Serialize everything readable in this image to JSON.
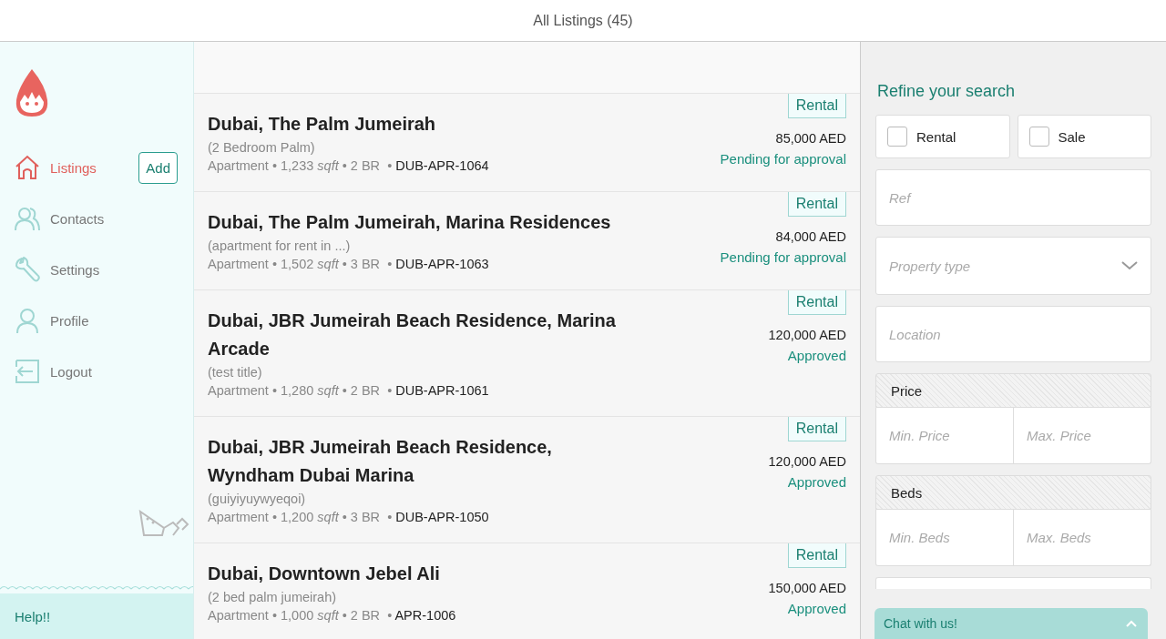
{
  "header": {
    "title": "All Listings (45)"
  },
  "sidebar": {
    "items": [
      {
        "label": "Listings",
        "selected": true
      },
      {
        "label": "Contacts",
        "selected": false
      },
      {
        "label": "Settings",
        "selected": false
      },
      {
        "label": "Profile",
        "selected": false
      },
      {
        "label": "Logout",
        "selected": false
      }
    ],
    "add_button": "Add",
    "help": "Help!!"
  },
  "listings": [
    {
      "title": "Dubai, The Palm Jumeirah",
      "subtitle": "(2 Bedroom Palm)",
      "details": "Apartment • 1,233 *sqft* • 2 BR  •",
      "ref": "DUB-APR-1064",
      "tag": "Rental",
      "price": "85,000 AED",
      "status": "Pending for approval"
    },
    {
      "title": "Dubai, The Palm Jumeirah, Marina Residences",
      "subtitle": "(apartment for rent in ...)",
      "details": "Apartment • 1,502 *sqft* • 3 BR  •",
      "ref": "DUB-APR-1063",
      "tag": "Rental",
      "price": "84,000 AED",
      "status": "Pending for approval"
    },
    {
      "title": "Dubai, JBR Jumeirah Beach Residence, Marina Arcade",
      "subtitle": "(test title)",
      "details": "Apartment • 1,280 *sqft* • 2 BR  •",
      "ref": "DUB-APR-1061",
      "tag": "Rental",
      "price": "120,000 AED",
      "status": "Approved"
    },
    {
      "title": "Dubai, JBR Jumeirah Beach Residence, Wyndham Dubai Marina",
      "subtitle": "(guiyiyuywyeqoi)",
      "details": "Apartment • 1,200 *sqft* • 3 BR  •",
      "ref": "DUB-APR-1050",
      "tag": "Rental",
      "price": "120,000 AED",
      "status": "Approved"
    },
    {
      "title": "Dubai, Downtown Jebel Ali",
      "subtitle": "(2 bed palm jumeirah)",
      "details": "Apartment • 1,000 *sqft* • 2 BR  •",
      "ref": "APR-1006",
      "tag": "Rental",
      "price": "150,000 AED",
      "status": "Approved"
    }
  ],
  "filters": {
    "title": "Refine your search",
    "checkboxes": [
      {
        "label": "Rental",
        "checked": false
      },
      {
        "label": "Sale",
        "checked": false
      }
    ],
    "fields": [
      {
        "kind": "text",
        "placeholder": "Ref"
      },
      {
        "kind": "select",
        "placeholder": "Property type"
      },
      {
        "kind": "text",
        "placeholder": "Location"
      }
    ],
    "ranges": [
      {
        "label": "Price",
        "min_placeholder": "Min. Price",
        "max_placeholder": "Max. Price"
      },
      {
        "label": "Beds",
        "min_placeholder": "Min. Beds",
        "max_placeholder": "Max. Beds"
      }
    ]
  },
  "chat": {
    "label": "Chat with us!"
  }
}
